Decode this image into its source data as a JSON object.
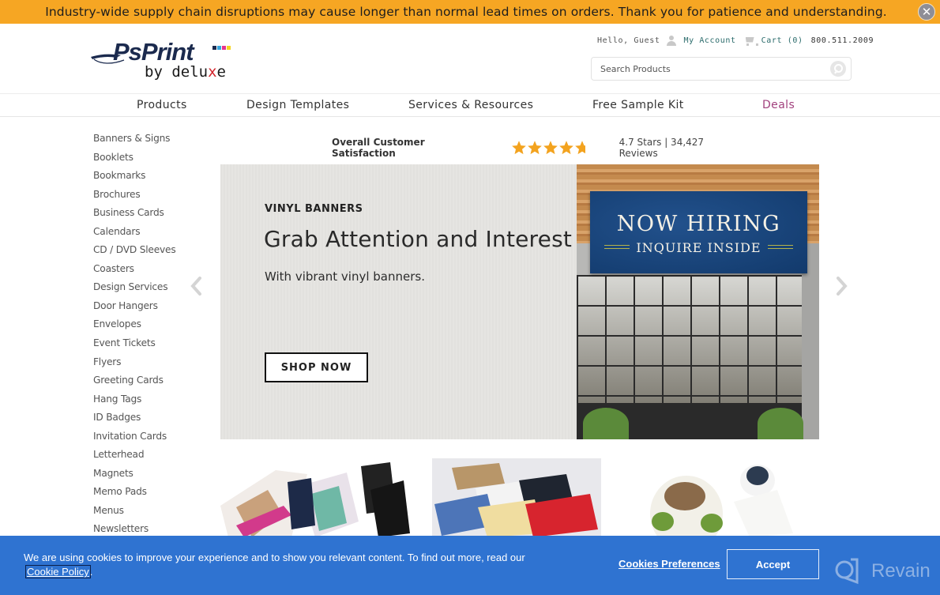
{
  "alert": {
    "message": "Industry-wide supply chain disruptions may cause longer than normal lead times on orders. Thank you for patience and understanding.",
    "close_icon": "close-circle-icon"
  },
  "header": {
    "logo": {
      "brand": "PsPrint",
      "tagline_prefix": "by delu",
      "tagline_x": "x",
      "tagline_suffix": "e"
    },
    "greeting": "Hello, Guest",
    "account_label": "My Account",
    "cart_label": "Cart (0)",
    "phone": "800.511.2009",
    "search": {
      "placeholder": "Search Products",
      "value": ""
    }
  },
  "nav": {
    "items": [
      {
        "label": "Products"
      },
      {
        "label": "Design Templates"
      },
      {
        "label": "Services & Resources"
      },
      {
        "label": "Free Sample Kit"
      },
      {
        "label": "Deals"
      }
    ],
    "deals_color": "#a2427e"
  },
  "sidebar": {
    "items": [
      "Banners & Signs",
      "Booklets",
      "Bookmarks",
      "Brochures",
      "Business Cards",
      "Calendars",
      "CD / DVD Sleeves",
      "Coasters",
      "Design Services",
      "Door Hangers",
      "Envelopes",
      "Event Tickets",
      "Flyers",
      "Greeting Cards",
      "Hang Tags",
      "ID Badges",
      "Invitation Cards",
      "Letterhead",
      "Magnets",
      "Memo Pads",
      "Menus",
      "Newsletters"
    ]
  },
  "rating": {
    "label": "Overall Customer Satisfaction",
    "stars_value": 4.7,
    "stars_max": 5,
    "text": "4.7 Stars | 34,427 Reviews",
    "star_color": "#f3a31f"
  },
  "hero": {
    "eyebrow": "VINYL BANNERS",
    "title": "Grab Attention and Interest",
    "subtitle": "With vibrant vinyl banners.",
    "cta": "SHOP NOW",
    "image_banner_line1": "NOW HIRING",
    "image_banner_line2": "INQUIRE INSIDE"
  },
  "cookie": {
    "message": "We are using cookies to improve your experience and to show you relevant content. To find out more, read our",
    "policy_link": "Cookie Policy",
    "policy_suffix": ".",
    "preferences": "Cookies Preferences",
    "accept": "Accept",
    "bg_color": "#2f73d1"
  },
  "watermark": {
    "text": "Revain"
  }
}
